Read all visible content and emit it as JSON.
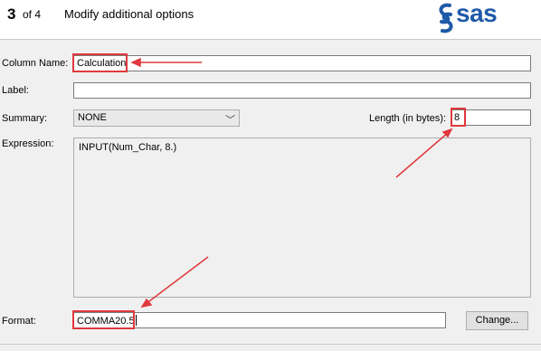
{
  "header": {
    "step_number": "3",
    "step_of": "of 4",
    "title": "Modify additional options",
    "logo_text": "sas"
  },
  "form": {
    "column_name_label": "Column Name:",
    "column_name_value": "Calculation",
    "label_label": "Label:",
    "label_value": "",
    "summary_label": "Summary:",
    "summary_value": "NONE",
    "length_label": "Length (in bytes):",
    "length_value": "8",
    "expression_label": "Expression:",
    "expression_value": "INPUT(Num_Char, 8.)",
    "format_label": "Format:",
    "format_value": "COMMA20.5",
    "change_button": "Change..."
  },
  "colors": {
    "highlight": "#e0393e",
    "brand": "#1f5aa8"
  }
}
